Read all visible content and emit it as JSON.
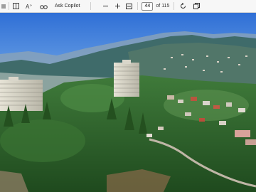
{
  "toolbar": {
    "ask_copilot_label": "Ask Copilot",
    "current_page": "44",
    "page_total": "of 115",
    "icons": [
      "menu-icon",
      "text-options-icon",
      "read-aloud-icon",
      "immersive-reader-icon",
      "zoom-out-icon",
      "zoom-in-icon",
      "fit-page-icon",
      "rotate-icon",
      "page-view-icon"
    ]
  },
  "document": {
    "content": "aerial photo of a hillside town with tall buildings and mountains"
  }
}
